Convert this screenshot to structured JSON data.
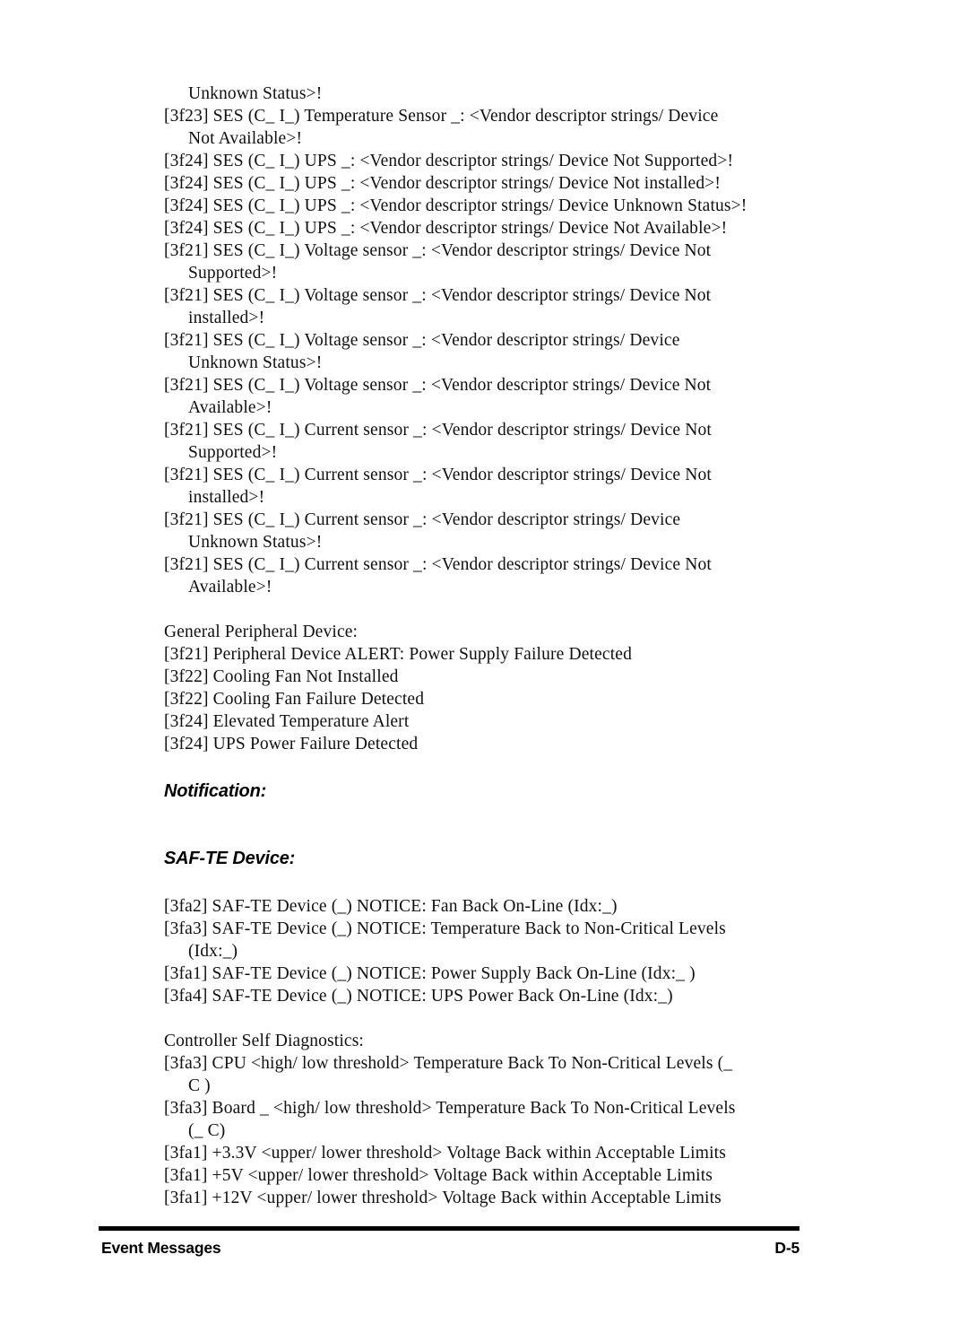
{
  "page": {
    "footer_section": "Event Messages",
    "page_number": "D-5"
  },
  "body": {
    "lines": [
      {
        "text": "Unknown Status>!",
        "cont": true
      },
      {
        "text": "[3f23] SES (C_ I_) Temperature Sensor _: <Vendor descriptor strings/ Device",
        "cont": false
      },
      {
        "text": "Not Available>!",
        "cont": true
      },
      {
        "text": "[3f24] SES (C_ I_) UPS _: <Vendor descriptor strings/ Device Not Supported>!",
        "cont": false
      },
      {
        "text": "[3f24] SES (C_ I_) UPS _: <Vendor descriptor strings/ Device Not installed>!",
        "cont": false
      },
      {
        "text": "[3f24] SES (C_ I_) UPS _: <Vendor descriptor strings/ Device Unknown Status>!",
        "cont": false
      },
      {
        "text": "[3f24] SES (C_ I_) UPS _: <Vendor descriptor strings/ Device Not Available>!",
        "cont": false
      },
      {
        "text": "[3f21] SES (C_ I_) Voltage sensor _: <Vendor descriptor strings/ Device Not",
        "cont": false
      },
      {
        "text": "Supported>!",
        "cont": true
      },
      {
        "text": "[3f21] SES (C_ I_) Voltage sensor _: <Vendor descriptor strings/ Device Not",
        "cont": false
      },
      {
        "text": "installed>!",
        "cont": true
      },
      {
        "text": "[3f21] SES (C_ I_) Voltage sensor _: <Vendor descriptor strings/ Device",
        "cont": false
      },
      {
        "text": "Unknown Status>!",
        "cont": true
      },
      {
        "text": "[3f21] SES (C_ I_) Voltage sensor _: <Vendor descriptor strings/ Device Not",
        "cont": false
      },
      {
        "text": "Available>!",
        "cont": true
      },
      {
        "text": "[3f21] SES (C_ I_) Current sensor _: <Vendor descriptor strings/ Device Not",
        "cont": false
      },
      {
        "text": "Supported>!",
        "cont": true
      },
      {
        "text": "[3f21] SES (C_ I_) Current sensor _: <Vendor descriptor strings/ Device Not",
        "cont": false
      },
      {
        "text": "installed>!",
        "cont": true
      },
      {
        "text": "[3f21] SES (C_ I_) Current sensor _: <Vendor descriptor strings/ Device",
        "cont": false
      },
      {
        "text": "Unknown Status>!",
        "cont": true
      },
      {
        "text": "[3f21] SES (C_ I_) Current sensor _: <Vendor descriptor strings/ Device Not",
        "cont": false
      },
      {
        "text": "Available>!",
        "cont": true
      }
    ]
  },
  "general_peripheral": {
    "title": "General Peripheral Device:",
    "lines": [
      "[3f21] Peripheral Device ALERT: Power Supply Failure Detected",
      "[3f22] Cooling Fan Not Installed",
      "[3f22] Cooling Fan Failure Detected",
      "[3f24] Elevated Temperature Alert",
      "[3f24] UPS Power Failure Detected"
    ]
  },
  "notification": {
    "heading": "Notification:",
    "safte_heading": "SAF-TE Device:",
    "safte_lines": [
      {
        "text": "[3fa2] SAF-TE Device (_) NOTICE: Fan Back On-Line (Idx:_)",
        "cont": false
      },
      {
        "text": "[3fa3] SAF-TE Device (_) NOTICE: Temperature Back to Non-Critical Levels",
        "cont": false
      },
      {
        "text": "(Idx:_)",
        "cont": true
      },
      {
        "text": "[3fa1] SAF-TE Device (_) NOTICE: Power Supply Back On-Line (Idx:_ )",
        "cont": false
      },
      {
        "text": "[3fa4] SAF-TE Device (_) NOTICE: UPS Power Back On-Line (Idx:_)",
        "cont": false
      }
    ]
  },
  "self_diagnostics": {
    "title": "Controller Self Diagnostics:",
    "lines": [
      {
        "text": "[3fa3] CPU <high/ low threshold> Temperature Back To Non-Critical Levels (_",
        "cont": false
      },
      {
        "text": "C )",
        "cont": true
      },
      {
        "text": "[3fa3] Board _ <high/ low threshold> Temperature Back To Non-Critical Levels",
        "cont": false
      },
      {
        "text": "(_ C)",
        "cont": true
      },
      {
        "text": "[3fa1] +3.3V <upper/ lower threshold> Voltage Back within Acceptable Limits",
        "cont": false
      },
      {
        "text": "[3fa1] +5V <upper/ lower threshold> Voltage Back within Acceptable Limits",
        "cont": false
      },
      {
        "text": "[3fa1] +12V <upper/ lower threshold> Voltage Back within Acceptable Limits",
        "cont": false
      }
    ]
  }
}
